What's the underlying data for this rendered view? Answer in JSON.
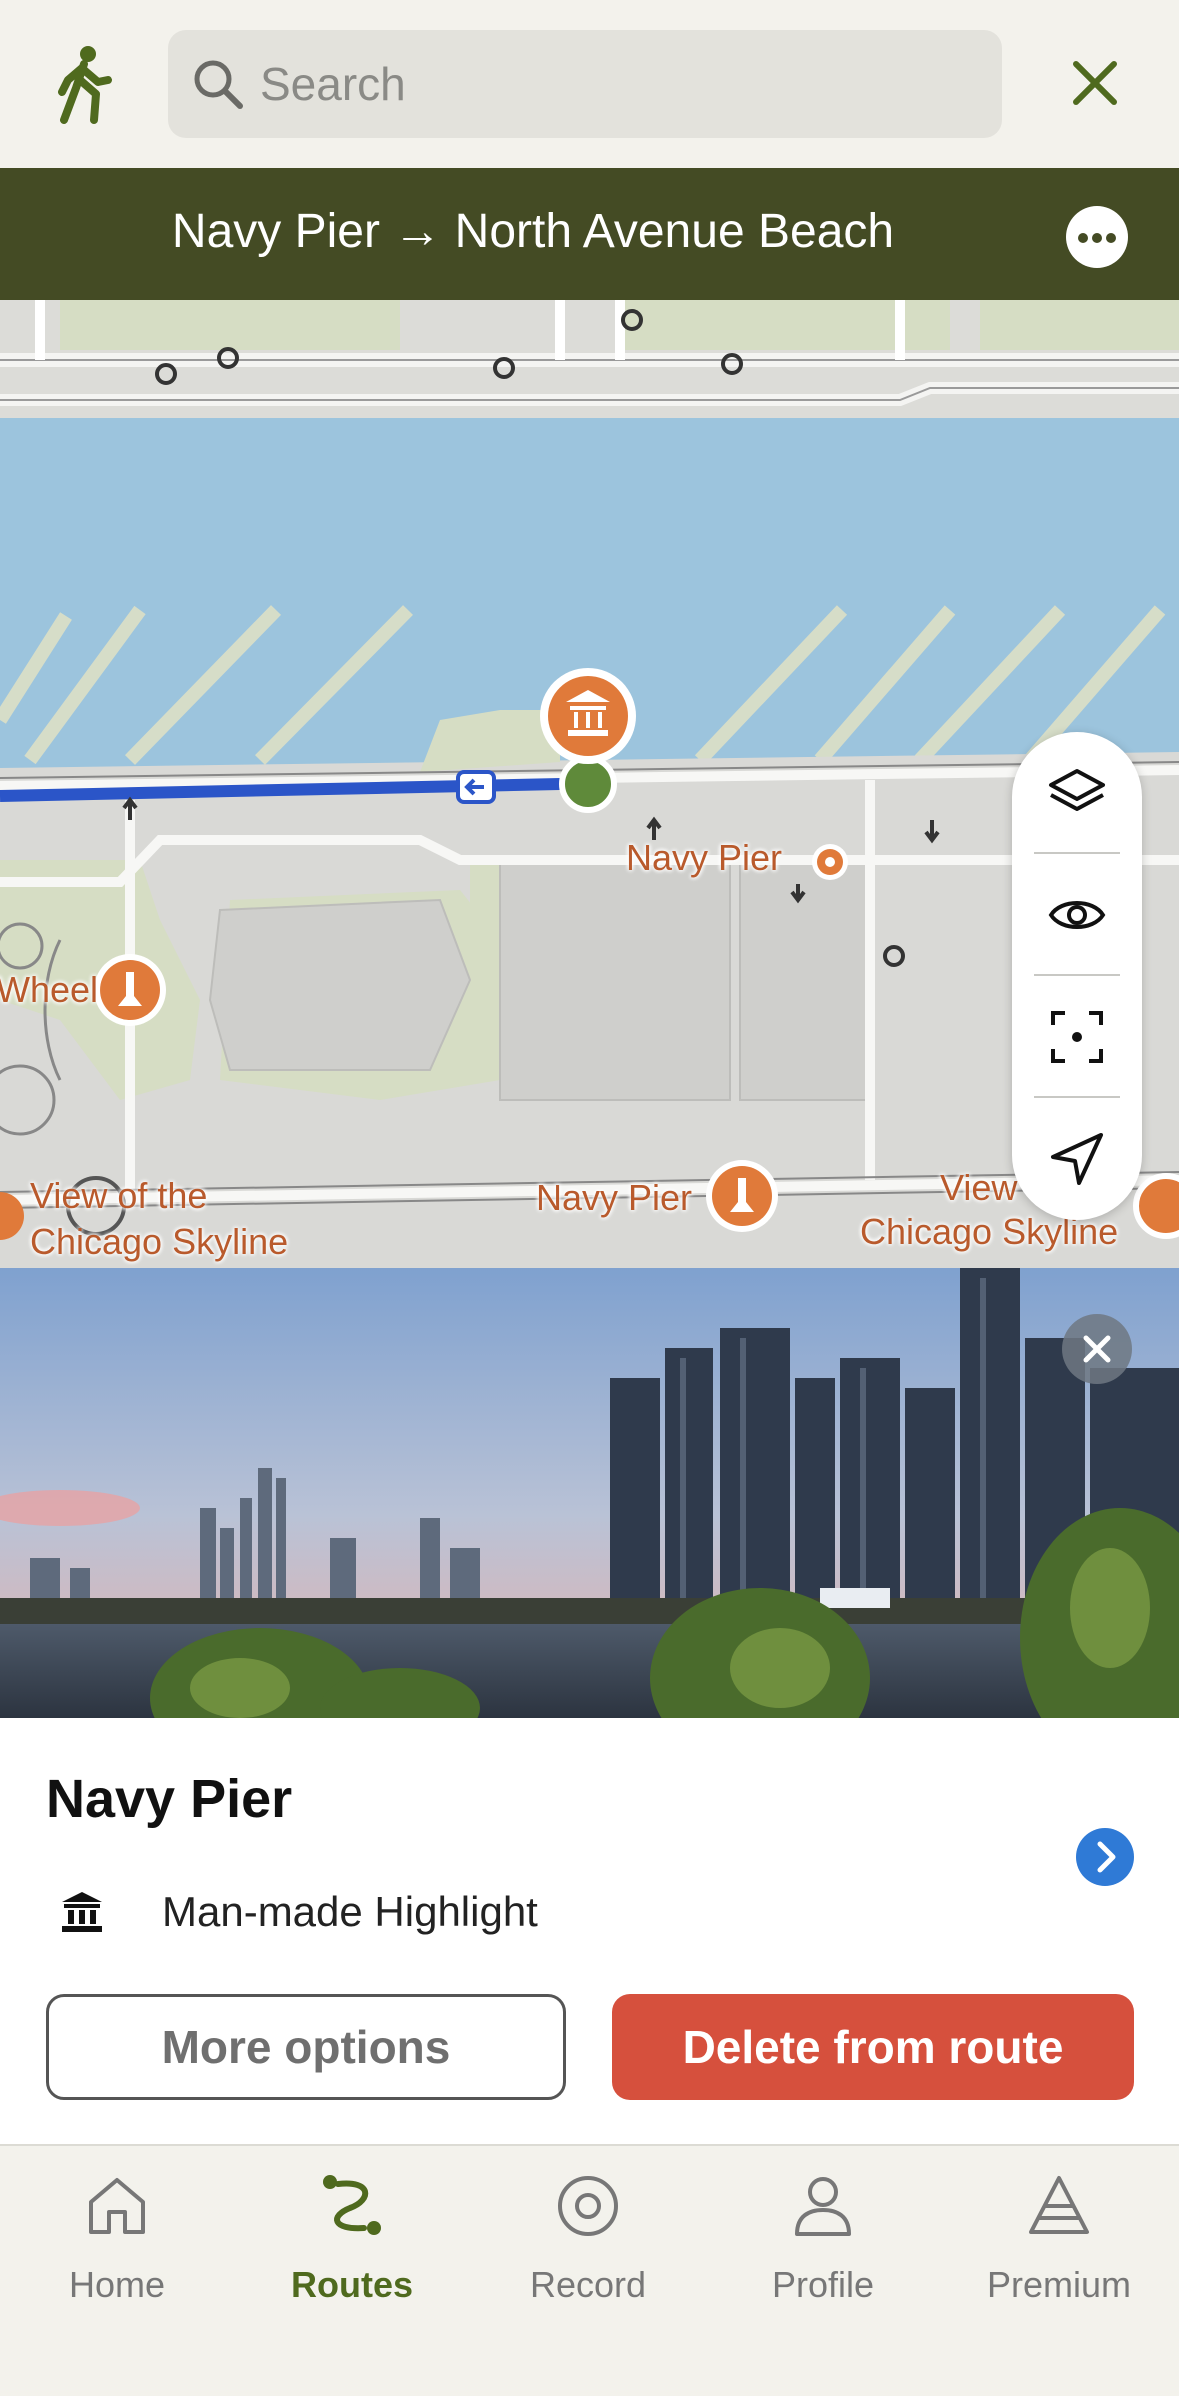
{
  "header": {
    "activity_icon": "walking-person-icon",
    "search": {
      "placeholder": "Search",
      "value": ""
    },
    "close_icon": "close-icon"
  },
  "route": {
    "title": "Navy Pier → North Avenue Beach",
    "more_icon": "more-horizontal-icon"
  },
  "map": {
    "labels": {
      "navy_pier_center": "Navy Pier",
      "wheel": "Wheel",
      "view_left_1": "View of the",
      "view_left_2": "Chicago Skyline",
      "navy_pier_bottom": "Navy Pier",
      "view_right_1": "View",
      "view_right_2": "Chicago Skyline"
    },
    "controls": [
      "layers-icon",
      "eye-icon",
      "focus-icon",
      "navigation-arrow-icon"
    ]
  },
  "photo": {
    "close_icon": "close-icon"
  },
  "place": {
    "name": "Navy Pier",
    "category": "Man-made Highlight",
    "category_icon": "monument-icon",
    "more_options": "More options",
    "delete": "Delete from route"
  },
  "nav": {
    "items": [
      {
        "label": "Home",
        "icon": "home-icon",
        "active": false
      },
      {
        "label": "Routes",
        "icon": "routes-icon",
        "active": true
      },
      {
        "label": "Record",
        "icon": "record-icon",
        "active": false
      },
      {
        "label": "Profile",
        "icon": "profile-icon",
        "active": false
      },
      {
        "label": "Premium",
        "icon": "premium-icon",
        "active": false
      }
    ]
  },
  "colors": {
    "route_bar": "#444b24",
    "accent_green": "#4f6a1e",
    "delete_red": "#d6503d",
    "poi_orange": "#e07a3a",
    "water": "#9cc4dd",
    "route_line": "#2b55c8"
  }
}
